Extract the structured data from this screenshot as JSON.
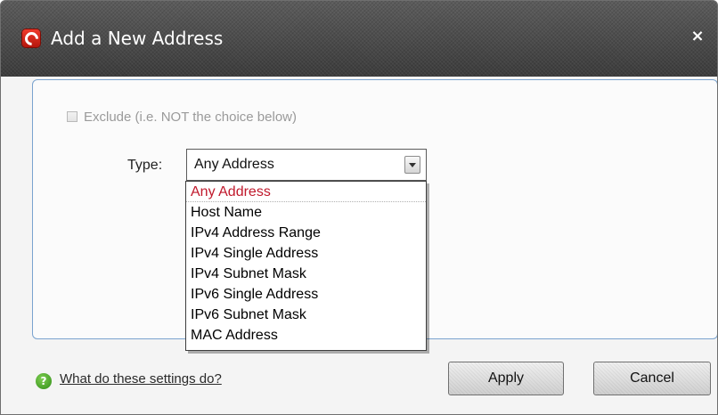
{
  "window": {
    "title": "Add a New Address",
    "close_glyph": "×",
    "logo_icon": "comodo-logo-icon"
  },
  "form": {
    "exclude": {
      "label": "Exclude (i.e. NOT the choice below)",
      "checked": false,
      "enabled": false
    },
    "type": {
      "label": "Type:",
      "selected": "Any Address",
      "options": [
        "Any Address",
        "Host Name",
        "IPv4 Address Range",
        "IPv4 Single Address",
        "IPv4 Subnet Mask",
        "IPv6 Single Address",
        "IPv6 Subnet Mask",
        "MAC Address"
      ],
      "expanded": true
    }
  },
  "footer": {
    "help_glyph": "?",
    "help_link": "What do these settings do?",
    "apply_label": "Apply",
    "cancel_label": "Cancel"
  },
  "colors": {
    "titlebar": "#4b4b4b",
    "panel_border": "#7aa3cf",
    "selected_option": "#c0192c",
    "help_icon": "#3f9e22"
  }
}
